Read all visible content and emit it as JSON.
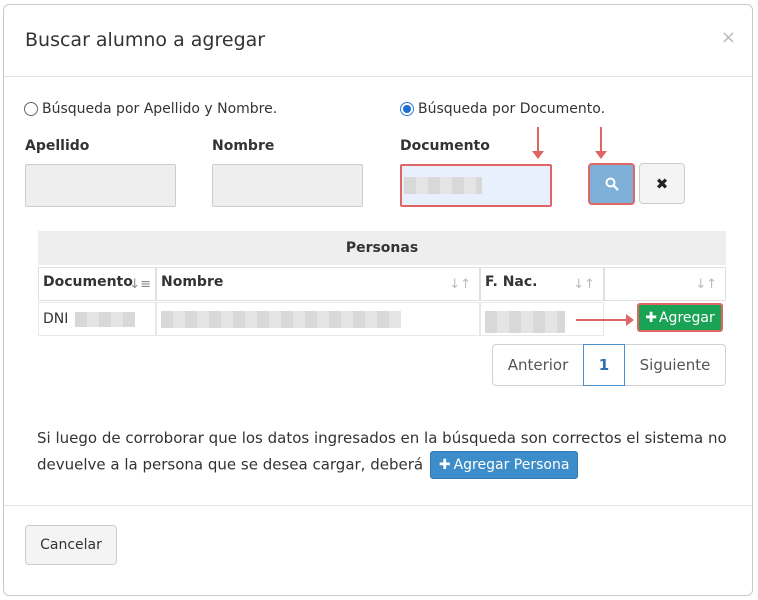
{
  "modal": {
    "title": "Buscar alumno a agregar",
    "close_icon": "close-icon"
  },
  "search": {
    "radio_name_label": "Búsqueda por Apellido y Nombre.",
    "radio_doc_label": "Búsqueda por Documento.",
    "selected_mode": "documento",
    "apellido_label": "Apellido",
    "nombre_label": "Nombre",
    "documento_label": "Documento",
    "search_icon": "search-icon",
    "clear_icon": "times-icon",
    "clear_label": "✖"
  },
  "table": {
    "caption": "Personas",
    "columns": [
      "Documento",
      "Nombre",
      "F. Nac.",
      ""
    ],
    "rows": [
      {
        "documento_prefix": "DNI",
        "documento_redacted": true,
        "nombre_redacted": true,
        "fnac_redacted": true,
        "action_label": "Agregar"
      }
    ]
  },
  "pagination": {
    "prev_label": "Anterior",
    "current_page": "1",
    "next_label": "Siguiente"
  },
  "info": {
    "text": "Si luego de corroborar que los datos ingresados en la búsqueda son correctos el sistema no devuelve a la persona que se desea cargar, deberá",
    "add_person_label": "Agregar Persona"
  },
  "footer": {
    "cancel_label": "Cancelar"
  },
  "colors": {
    "highlight": "#e06666",
    "primary": "#3c8dc9",
    "success": "#1aa355"
  }
}
